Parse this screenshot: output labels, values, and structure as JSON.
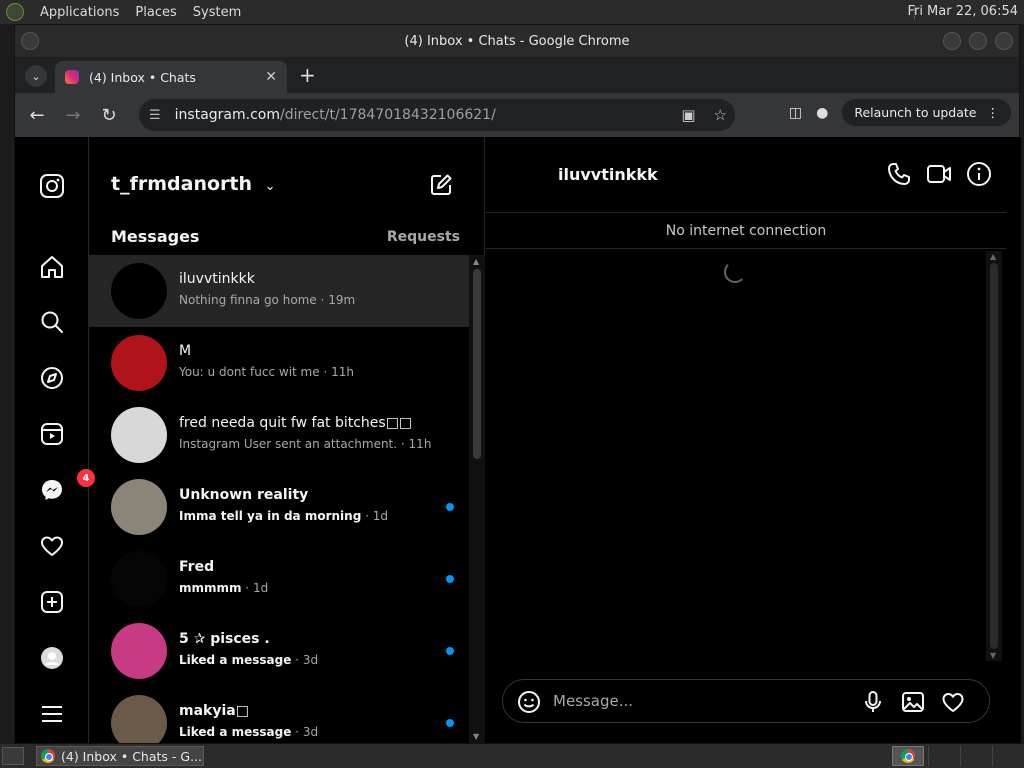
{
  "system_bar": {
    "menus": [
      "Applications",
      "Places",
      "System"
    ],
    "clock": "Fri Mar 22, 06:54"
  },
  "window": {
    "title": "(4) Inbox • Chats - Google Chrome"
  },
  "browser": {
    "tab_title": "(4) Inbox • Chats",
    "url_host": "instagram.com",
    "url_path": "/direct/t/17847018432106621/",
    "relaunch_label": "Relaunch to update"
  },
  "inbox": {
    "username": "t_frmdanorth",
    "messages_label": "Messages",
    "requests_label": "Requests",
    "notification_count": "4",
    "conversations": [
      {
        "name": "iluvvtinkkk",
        "preview": "Nothing finna go home",
        "time": "19m",
        "unread": false,
        "active": true,
        "avatar": "#000000"
      },
      {
        "name": "M",
        "preview": "You: u dont fucc wit me",
        "time": "11h",
        "unread": false,
        "active": false,
        "avatar": "#b0131a"
      },
      {
        "name": "fred needa quit fw fat bitches□□",
        "preview": "Instagram User sent an attachment.",
        "time": "11h",
        "unread": false,
        "active": false,
        "avatar": "#d8d8d8"
      },
      {
        "name": "Unknown reality",
        "preview": "Imma tell ya in da morning",
        "time": "1d",
        "unread": true,
        "active": false,
        "avatar": "#8a8578"
      },
      {
        "name": "Fred",
        "preview": "mmmmm",
        "time": "1d",
        "unread": true,
        "active": false,
        "avatar": "#050505"
      },
      {
        "name": "5 ✰ pisces .",
        "preview": "Liked a message",
        "time": "3d",
        "unread": true,
        "active": false,
        "avatar": "#c63a86"
      },
      {
        "name": "makyia□",
        "preview": "Liked a message",
        "time": "3d",
        "unread": true,
        "active": false,
        "avatar": "#6b5a4a"
      }
    ]
  },
  "chat": {
    "username": "iluvvtinkkk",
    "notice": "No internet connection",
    "message_placeholder": "Message..."
  },
  "taskbar": {
    "task_label": "(4) Inbox • Chats - G..."
  },
  "colors": {
    "unread_dot": "#0095f6",
    "badge": "#ff3040",
    "background": "#000000"
  }
}
